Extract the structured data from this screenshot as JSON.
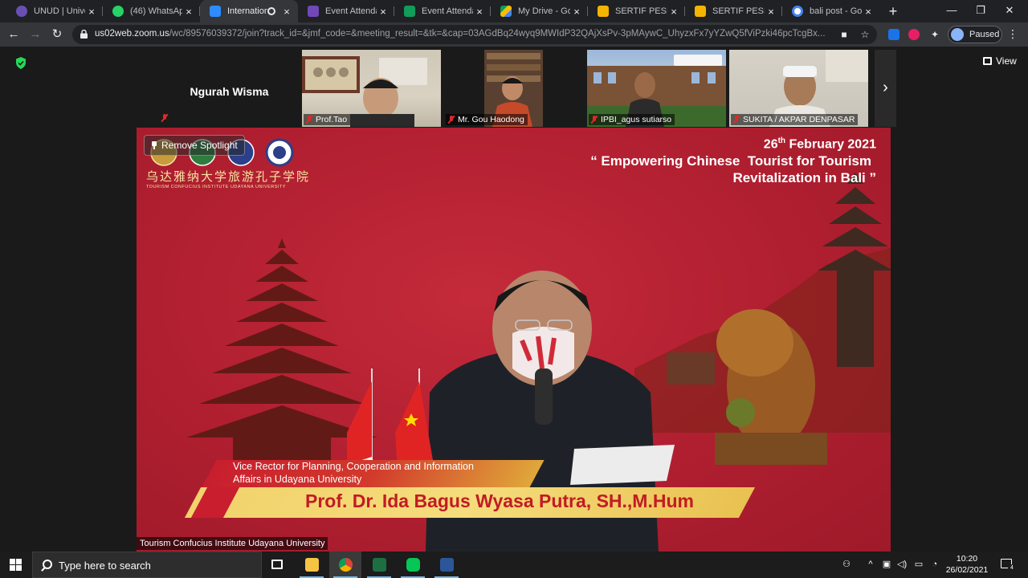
{
  "browser": {
    "tabs": [
      {
        "title": "UNUD | Univers",
        "favicon_color": "#6a4fb3"
      },
      {
        "title": "(46) WhatsApp",
        "favicon_color": "#25d366"
      },
      {
        "title": "Internation",
        "favicon_color": "#2d8cff",
        "active": true
      },
      {
        "title": "Event Attendan",
        "favicon_color": "#7248b9"
      },
      {
        "title": "Event Attendan",
        "favicon_color": "#0f9d58"
      },
      {
        "title": "My Drive - Goo",
        "favicon_color": "#fbbc04"
      },
      {
        "title": "SERTIF PESERTA",
        "favicon_color": "#f4b400"
      },
      {
        "title": "SERTIF PESERTA",
        "favicon_color": "#f4b400"
      },
      {
        "title": "bali post - Goo",
        "favicon_color": "#4285f4"
      }
    ],
    "url_host": "us02web.zoom.us",
    "url_path": "/wc/89576039372/join?track_id=&jmf_code=&meeting_result=&tk=&cap=03AGdBq24wyq9MWIdP32QAjXsPv-3pMAywC_UhyzxFx7yYZwQ5fViPzki46pcTcgBx...",
    "profile_label": "Paused"
  },
  "zoom": {
    "view_label": "View",
    "participants": [
      {
        "name": "Ngurah Wisma",
        "video": false
      },
      {
        "name": "Prof.Tao",
        "video": true
      },
      {
        "name": "Mr. Gou Haodong",
        "video": true
      },
      {
        "name": "IPBI_agus sutiarso",
        "video": true
      },
      {
        "name": "SUKITA / AKPAR DENPASAR",
        "video": true
      }
    ],
    "spotlight": {
      "button_label": "Remove Spotlight",
      "chinese_title": "乌达雅纳大学旅游孔子学院",
      "institute_en": "TOURISM CONFUCIUS INSTITUTE UDAYANA UNIVERSITY",
      "date_day": "26",
      "date_suffix": "th",
      "date_rest": " February 2021",
      "theme_line1": "“ Empowering Chinese  Tourist for Tourism",
      "theme_line2": "Revitalization in Bali ”",
      "speaker_role_line1": "Vice Rector for Planning, Cooperation and Information",
      "speaker_role_line2": "Affairs in Udayana University",
      "speaker_name": "Prof. Dr. Ida Bagus Wyasa Putra, SH.,M.Hum",
      "participant_label": "Tourism Confucius Institute Udayana University"
    }
  },
  "taskbar": {
    "search_placeholder": "Type here to search",
    "time": "10:20",
    "date": "26/02/2021",
    "notification_count": "4"
  }
}
